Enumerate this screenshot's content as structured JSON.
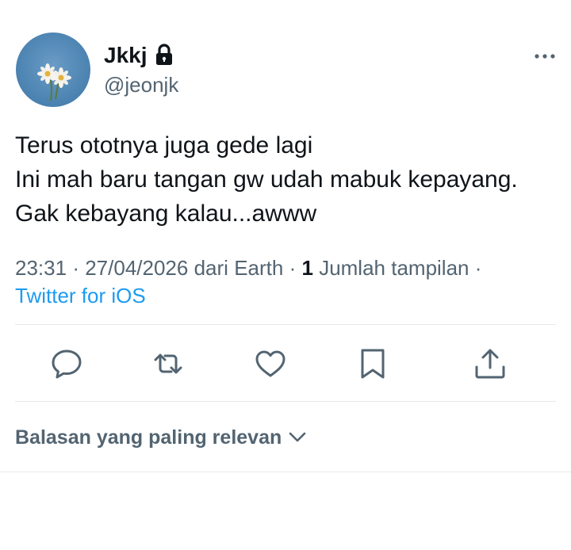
{
  "author": {
    "display_name": "Jkkj",
    "handle": "@jeonjk",
    "avatar_icon": "daisy-flowers-avatar",
    "protected_icon": "lock-icon"
  },
  "tweet": {
    "lines": [
      "Terus ototnya juga gede lagi",
      "Ini mah baru tangan gw udah mabuk kepayang.",
      "Gak kebayang kalau...awww"
    ]
  },
  "meta": {
    "time": "23:31",
    "date": "27/04/2026",
    "location_prefix": "dari",
    "location": "Earth",
    "separator": "·",
    "views_count": "1",
    "views_label": "Jumlah tampilan",
    "source": "Twitter for iOS"
  },
  "actions": [
    {
      "name": "reply",
      "icon": "reply-icon"
    },
    {
      "name": "retweet",
      "icon": "retweet-icon"
    },
    {
      "name": "like",
      "icon": "heart-icon"
    },
    {
      "name": "bookmark",
      "icon": "bookmark-icon"
    },
    {
      "name": "share",
      "icon": "share-icon"
    }
  ],
  "replies": {
    "sort_label": "Balasan yang paling relevan"
  },
  "colors": {
    "text_primary": "#0f1419",
    "text_secondary": "#536471",
    "link": "#1d9bf0",
    "avatar_sky": "#4e86b5",
    "divider": "#e6e9eb"
  }
}
